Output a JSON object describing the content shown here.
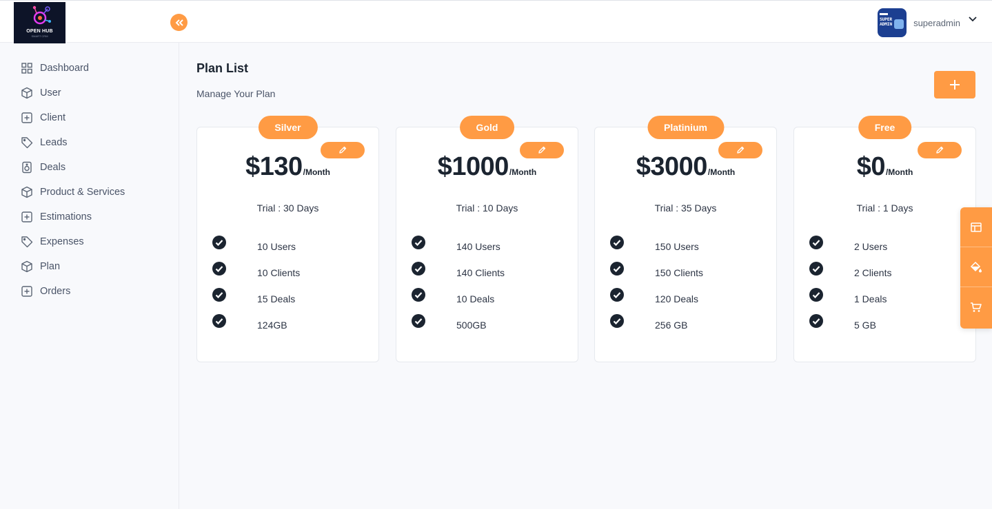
{
  "brand": {
    "logo_text": "OPEN HUB",
    "logo_sub": "SMART CRM"
  },
  "header": {
    "username": "superadmin",
    "avatar_text_1": "SUPER",
    "avatar_text_2": "ADMIN"
  },
  "sidebar": {
    "items": [
      {
        "label": "Dashboard",
        "icon": "dashboard-grid-icon"
      },
      {
        "label": "User",
        "icon": "cube-icon"
      },
      {
        "label": "Client",
        "icon": "plus-square-icon"
      },
      {
        "label": "Leads",
        "icon": "tag-icon"
      },
      {
        "label": "Deals",
        "icon": "speaker-icon"
      },
      {
        "label": "Product & Services",
        "icon": "cube-icon"
      },
      {
        "label": "Estimations",
        "icon": "plus-square-icon"
      },
      {
        "label": "Expenses",
        "icon": "tag-icon"
      },
      {
        "label": "Plan",
        "icon": "cube-icon"
      },
      {
        "label": "Orders",
        "icon": "plus-square-icon"
      }
    ]
  },
  "main": {
    "title": "Plan List",
    "subtitle": "Manage Your Plan",
    "plans": [
      {
        "name": "Silver",
        "price": "$130",
        "period": "/Month",
        "trial": "Trial : 30 Days",
        "features": [
          "10 Users",
          "10 Clients",
          "15 Deals",
          "124GB"
        ]
      },
      {
        "name": "Gold",
        "price": "$1000",
        "period": "/Month",
        "trial": "Trial : 10 Days",
        "features": [
          "140 Users",
          "140 Clients",
          "10 Deals",
          "500GB"
        ]
      },
      {
        "name": "Platinium",
        "price": "$3000",
        "period": "/Month",
        "trial": "Trial : 35 Days",
        "features": [
          "150 Users",
          "150 Clients",
          "120 Deals",
          "256 GB"
        ]
      },
      {
        "name": "Free",
        "price": "$0",
        "period": "/Month",
        "trial": "Trial : 1 Days",
        "features": [
          "2 Users",
          "2 Clients",
          "1 Deals",
          "5 GB"
        ]
      }
    ]
  },
  "side_panel": {
    "icons": [
      "layout-icon",
      "paint-bucket-icon",
      "cart-icon"
    ]
  },
  "colors": {
    "accent": "#ff9b44",
    "text_dark": "#1b2430",
    "text_muted": "#4a5468",
    "logo_bg": "#0d1428"
  }
}
